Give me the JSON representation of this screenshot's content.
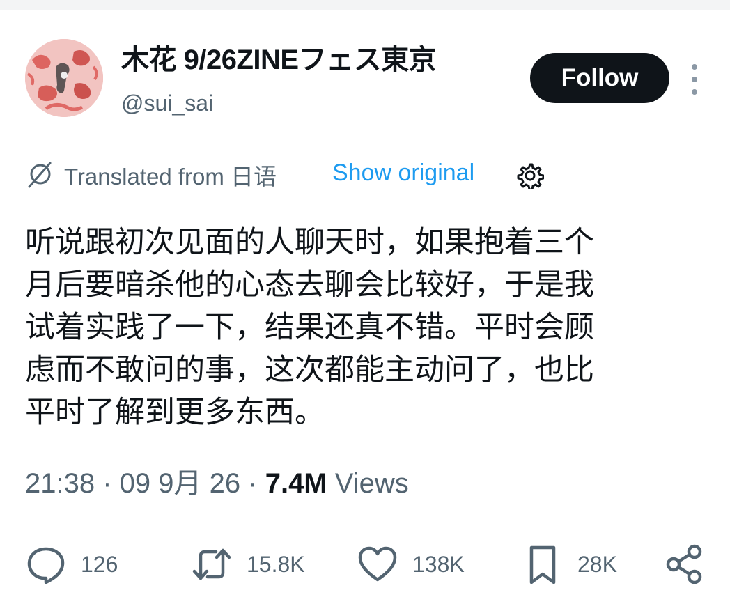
{
  "user": {
    "display_name": "木花 9/26ZINEフェス東京",
    "handle": "@sui_sai",
    "avatar_icon": "avatar-icon"
  },
  "header": {
    "follow_label": "Follow",
    "more_icon": "more-options-icon"
  },
  "translation": {
    "translated_from": "Translated from 日语",
    "show_original": "Show original",
    "accent_color": "#1d9bf0"
  },
  "tweet": {
    "text": "听说跟初次见面的人聊天时，如果抱着三个\n月后要暗杀他的心态去聊会比较好，于是我\n试着实践了一下，结果还真不错。平时会顾\n虑而不敢问的事，这次都能主动问了，也比\n平时了解到更多东西。"
  },
  "meta": {
    "time": "21:38",
    "date": "09 9月 26",
    "views_count": "7.4M",
    "views_label": "Views"
  },
  "actions": {
    "replies": "126",
    "reposts": "15.8K",
    "likes": "138K",
    "bookmarks": "28K"
  },
  "colors": {
    "text_primary": "#0f1419",
    "text_secondary": "#536471",
    "button_bg": "#0f1419"
  }
}
